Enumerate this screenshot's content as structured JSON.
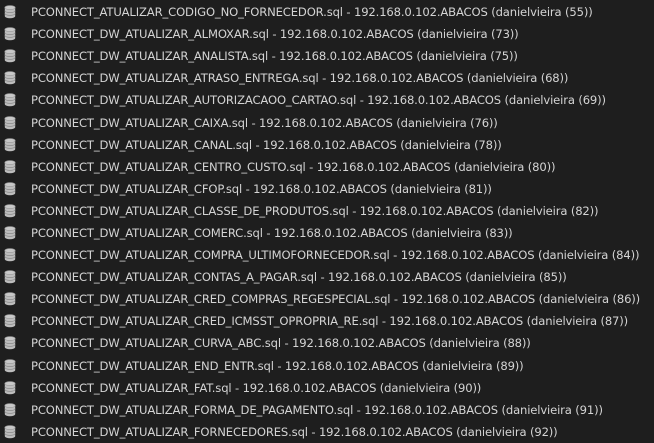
{
  "icon_name": "database-icon",
  "items": [
    {
      "label": "PCONNECT_ATUALIZAR_CODIGO_NO_FORNECEDOR.sql - 192.168.0.102.ABACOS (danielvieira (55))"
    },
    {
      "label": "PCONNECT_DW_ATUALIZAR_ALMOXAR.sql - 192.168.0.102.ABACOS (danielvieira (73))"
    },
    {
      "label": "PCONNECT_DW_ATUALIZAR_ANALISTA.sql - 192.168.0.102.ABACOS (danielvieira (75))"
    },
    {
      "label": "PCONNECT_DW_ATUALIZAR_ATRASO_ENTREGA.sql - 192.168.0.102.ABACOS (danielvieira (68))"
    },
    {
      "label": "PCONNECT_DW_ATUALIZAR_AUTORIZACAOO_CARTAO.sql - 192.168.0.102.ABACOS (danielvieira (69))"
    },
    {
      "label": "PCONNECT_DW_ATUALIZAR_CAIXA.sql - 192.168.0.102.ABACOS (danielvieira (76))"
    },
    {
      "label": "PCONNECT_DW_ATUALIZAR_CANAL.sql - 192.168.0.102.ABACOS (danielvieira (78))"
    },
    {
      "label": "PCONNECT_DW_ATUALIZAR_CENTRO_CUSTO.sql - 192.168.0.102.ABACOS (danielvieira (80))"
    },
    {
      "label": "PCONNECT_DW_ATUALIZAR_CFOP.sql - 192.168.0.102.ABACOS (danielvieira (81))"
    },
    {
      "label": "PCONNECT_DW_ATUALIZAR_CLASSE_DE_PRODUTOS.sql - 192.168.0.102.ABACOS (danielvieira (82))"
    },
    {
      "label": "PCONNECT_DW_ATUALIZAR_COMERC.sql - 192.168.0.102.ABACOS (danielvieira (83))"
    },
    {
      "label": "PCONNECT_DW_ATUALIZAR_COMPRA_ULTIMOFORNECEDOR.sql - 192.168.0.102.ABACOS (danielvieira (84))"
    },
    {
      "label": "PCONNECT_DW_ATUALIZAR_CONTAS_A_PAGAR.sql - 192.168.0.102.ABACOS (danielvieira (85))"
    },
    {
      "label": "PCONNECT_DW_ATUALIZAR_CRED_COMPRAS_REGESPECIAL.sql - 192.168.0.102.ABACOS (danielvieira (86))"
    },
    {
      "label": "PCONNECT_DW_ATUALIZAR_CRED_ICMSST_OPROPRIA_RE.sql - 192.168.0.102.ABACOS (danielvieira (87))"
    },
    {
      "label": "PCONNECT_DW_ATUALIZAR_CURVA_ABC.sql - 192.168.0.102.ABACOS (danielvieira (88))"
    },
    {
      "label": "PCONNECT_DW_ATUALIZAR_END_ENTR.sql - 192.168.0.102.ABACOS (danielvieira (89))"
    },
    {
      "label": "PCONNECT_DW_ATUALIZAR_FAT.sql - 192.168.0.102.ABACOS (danielvieira (90))"
    },
    {
      "label": "PCONNECT_DW_ATUALIZAR_FORMA_DE_PAGAMENTO.sql - 192.168.0.102.ABACOS (danielvieira (91))"
    },
    {
      "label": "PCONNECT_DW_ATUALIZAR_FORNECEDORES.sql - 192.168.0.102.ABACOS (danielvieira (92))"
    }
  ]
}
